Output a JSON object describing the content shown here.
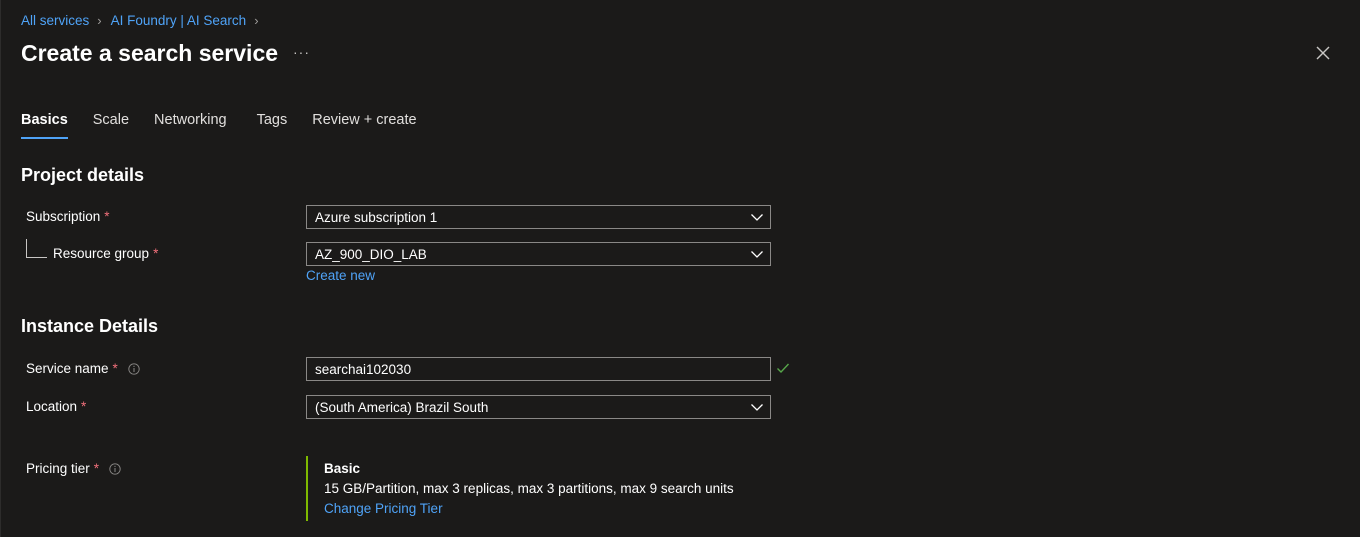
{
  "breadcrumb": {
    "items": [
      {
        "label": "All services"
      },
      {
        "label": "AI Foundry | AI Search"
      }
    ]
  },
  "page": {
    "title": "Create a search service",
    "more_label": "···"
  },
  "tabs": [
    {
      "label": "Basics",
      "active": true
    },
    {
      "label": "Scale",
      "active": false
    },
    {
      "label": "Networking",
      "active": false
    },
    {
      "label": "Tags",
      "active": false
    },
    {
      "label": "Review + create",
      "active": false
    }
  ],
  "project_details": {
    "title": "Project details",
    "subscription": {
      "label": "Subscription",
      "required_mark": "*",
      "value": "Azure subscription 1"
    },
    "resource_group": {
      "label": "Resource group",
      "required_mark": "*",
      "value": "AZ_900_DIO_LAB",
      "create_new_label": "Create new"
    }
  },
  "instance_details": {
    "title": "Instance Details",
    "service_name": {
      "label": "Service name",
      "required_mark": "*",
      "value": "searchai102030",
      "valid": true
    },
    "location": {
      "label": "Location",
      "required_mark": "*",
      "value": "(South America) Brazil South"
    },
    "pricing_tier": {
      "label": "Pricing tier",
      "required_mark": "*",
      "tier_name": "Basic",
      "tier_description": "15 GB/Partition, max 3 replicas, max 3 partitions, max 9 search units",
      "change_label": "Change Pricing Tier"
    }
  },
  "colors": {
    "background": "#1b1a19",
    "link": "#4fa3f7",
    "required": "#f1707b",
    "valid_check": "#57a64a",
    "tier_accent": "#7fba00"
  },
  "icons": {
    "close": "close-icon",
    "more": "more-icon",
    "dropdown": "chevron-down-icon",
    "info": "info-icon",
    "valid": "check-icon"
  }
}
